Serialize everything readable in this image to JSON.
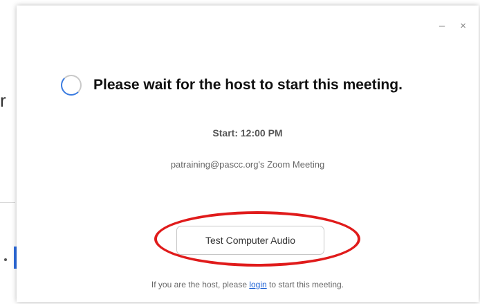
{
  "background": {
    "fragment_char": "r"
  },
  "dialog": {
    "controls": {
      "minimize": "–",
      "close": "×"
    },
    "title": "Please wait for the host to start this meeting.",
    "start_time": "Start: 12:00 PM",
    "meeting_name": "patraining@pascc.org's  Zoom Meeting",
    "audio_button": "Test Computer Audio",
    "footer": {
      "prefix": "If you are the host, please ",
      "link": "login",
      "suffix": " to start this meeting."
    }
  },
  "colors": {
    "accent_blue": "#3a7be0",
    "highlight_red": "#e01b1b",
    "link_blue": "#1a5fd4"
  }
}
